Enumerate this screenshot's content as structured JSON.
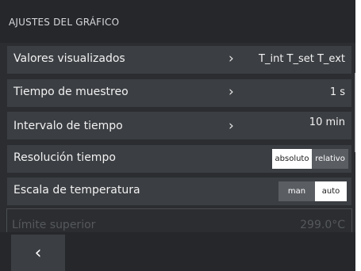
{
  "header": {
    "title": "AJUSTES DEL GRÁFICO"
  },
  "rows": [
    {
      "label": "Valores visualizados",
      "chevron": "›",
      "value": "T_int T_set T_ext"
    },
    {
      "label": "Tiempo de muestreo",
      "chevron": "›",
      "value": "1 s"
    },
    {
      "label": "Intervalo de tiempo",
      "chevron": "›",
      "value": "10 min"
    }
  ],
  "resolution": {
    "label": "Resolución tiempo",
    "options": [
      "absoluto",
      "relativo"
    ],
    "selected": "absoluto"
  },
  "temperature_scale": {
    "label": "Escala de temperatura",
    "options": [
      "man",
      "auto"
    ],
    "selected": "auto"
  },
  "upper_limit": {
    "label": "Límite superior",
    "value": "299.0°C"
  },
  "footer": {
    "back_icon": "‹"
  },
  "colors": {
    "background": "#2b2d30",
    "row": "#3b3e42",
    "selected_option": "#ffffff",
    "unselected_option": "#5a5d62"
  }
}
